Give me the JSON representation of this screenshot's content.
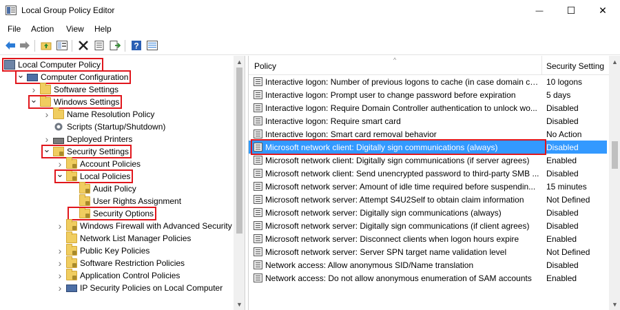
{
  "window": {
    "title": "Local Group Policy Editor",
    "minimize_glyph": "—",
    "maximize_glyph": "☐",
    "close_glyph": "✕"
  },
  "menu": [
    "File",
    "Action",
    "View",
    "Help"
  ],
  "toolbar_icons": [
    "back-icon",
    "forward-icon",
    "up-folder-icon",
    "show-hide-tree-icon",
    "delete-icon",
    "properties-icon",
    "export-list-icon",
    "help-icon",
    "filter-icon"
  ],
  "tree": [
    {
      "label": "Local Computer Policy",
      "icon": "policy-icon",
      "indent": 0,
      "chevron": "",
      "highlighted": true
    },
    {
      "label": "Computer Configuration",
      "icon": "computer-icon",
      "indent": 1,
      "chevron": "v",
      "highlighted": true
    },
    {
      "label": "Software Settings",
      "icon": "folder-icon",
      "indent": 2,
      "chevron": ">",
      "highlighted": false
    },
    {
      "label": "Windows Settings",
      "icon": "folder-icon",
      "indent": 2,
      "chevron": "v",
      "highlighted": true
    },
    {
      "label": "Name Resolution Policy",
      "icon": "folder-icon",
      "indent": 3,
      "chevron": ">",
      "highlighted": false
    },
    {
      "label": "Scripts (Startup/Shutdown)",
      "icon": "scripts-icon",
      "indent": 3,
      "chevron": "",
      "highlighted": false
    },
    {
      "label": "Deployed Printers",
      "icon": "printer-icon",
      "indent": 3,
      "chevron": ">",
      "highlighted": false
    },
    {
      "label": "Security Settings",
      "icon": "security-settings-icon",
      "indent": 3,
      "chevron": "v",
      "highlighted": true
    },
    {
      "label": "Account Policies",
      "icon": "locked-folder-icon",
      "indent": 4,
      "chevron": ">",
      "highlighted": false
    },
    {
      "label": "Local Policies",
      "icon": "locked-folder-icon",
      "indent": 4,
      "chevron": "v",
      "highlighted": true
    },
    {
      "label": "Audit Policy",
      "icon": "locked-folder-icon",
      "indent": 5,
      "chevron": "",
      "highlighted": false
    },
    {
      "label": "User Rights Assignment",
      "icon": "locked-folder-icon",
      "indent": 5,
      "chevron": "",
      "highlighted": false
    },
    {
      "label": "Security Options",
      "icon": "locked-folder-icon",
      "indent": 5,
      "chevron": "",
      "highlighted": true
    },
    {
      "label": "Windows Firewall with Advanced Security",
      "icon": "locked-folder-icon",
      "indent": 4,
      "chevron": ">",
      "highlighted": false
    },
    {
      "label": "Network List Manager Policies",
      "icon": "folder-icon",
      "indent": 4,
      "chevron": "",
      "highlighted": false
    },
    {
      "label": "Public Key Policies",
      "icon": "locked-folder-icon",
      "indent": 4,
      "chevron": ">",
      "highlighted": false
    },
    {
      "label": "Software Restriction Policies",
      "icon": "locked-folder-icon",
      "indent": 4,
      "chevron": ">",
      "highlighted": false
    },
    {
      "label": "Application Control Policies",
      "icon": "locked-folder-icon",
      "indent": 4,
      "chevron": ">",
      "highlighted": false
    },
    {
      "label": "IP Security Policies on Local Computer",
      "icon": "ip-security-icon",
      "indent": 4,
      "chevron": ">",
      "highlighted": false
    }
  ],
  "list": {
    "columns": {
      "policy": "Policy",
      "setting": "Security Setting"
    },
    "rows": [
      {
        "policy": "Interactive logon: Number of previous logons to cache (in case domain co...",
        "setting": "10 logons",
        "selected": false
      },
      {
        "policy": "Interactive logon: Prompt user to change password before expiration",
        "setting": "5 days",
        "selected": false
      },
      {
        "policy": "Interactive logon: Require Domain Controller authentication to unlock wo...",
        "setting": "Disabled",
        "selected": false
      },
      {
        "policy": "Interactive logon: Require smart card",
        "setting": "Disabled",
        "selected": false
      },
      {
        "policy": "Interactive logon: Smart card removal behavior",
        "setting": "No Action",
        "selected": false
      },
      {
        "policy": "Microsoft network client: Digitally sign communications (always)",
        "setting": "Disabled",
        "selected": true
      },
      {
        "policy": "Microsoft network client: Digitally sign communications (if server agrees)",
        "setting": "Enabled",
        "selected": false
      },
      {
        "policy": "Microsoft network client: Send unencrypted password to third-party SMB ...",
        "setting": "Disabled",
        "selected": false
      },
      {
        "policy": "Microsoft network server: Amount of idle time required before suspendin...",
        "setting": "15 minutes",
        "selected": false
      },
      {
        "policy": "Microsoft network server: Attempt S4U2Self to obtain claim information",
        "setting": "Not Defined",
        "selected": false
      },
      {
        "policy": "Microsoft network server: Digitally sign communications (always)",
        "setting": "Disabled",
        "selected": false
      },
      {
        "policy": "Microsoft network server: Digitally sign communications (if client agrees)",
        "setting": "Disabled",
        "selected": false
      },
      {
        "policy": "Microsoft network server: Disconnect clients when logon hours expire",
        "setting": "Enabled",
        "selected": false
      },
      {
        "policy": "Microsoft network server: Server SPN target name validation level",
        "setting": "Not Defined",
        "selected": false
      },
      {
        "policy": "Network access: Allow anonymous SID/Name translation",
        "setting": "Disabled",
        "selected": false
      },
      {
        "policy": "Network access: Do not allow anonymous enumeration of SAM accounts",
        "setting": "Enabled",
        "selected": false
      }
    ]
  },
  "colors": {
    "selection": "#3399ff",
    "highlight_box": "#e0151b",
    "folder": "#f0cd60"
  }
}
